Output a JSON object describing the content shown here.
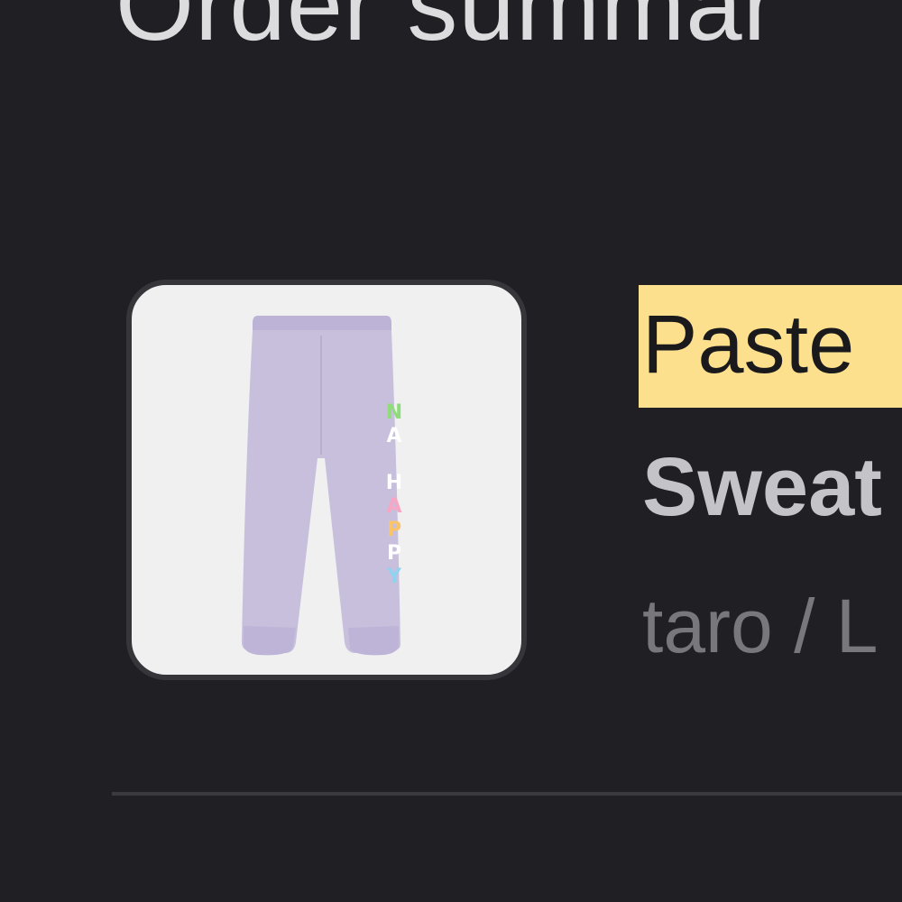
{
  "header": {
    "title": "Order summar"
  },
  "line_item": {
    "image_icon": "sweatpants-product-image",
    "print_letters": [
      "N",
      "A",
      "H",
      "A",
      "P",
      "P",
      "Y"
    ],
    "name_line1": "Paste",
    "name_line2": "Sweat",
    "variant": "taro / L"
  },
  "colors": {
    "background": "#202024",
    "highlight": "#fce08e",
    "pants": "#c7bfdc"
  }
}
